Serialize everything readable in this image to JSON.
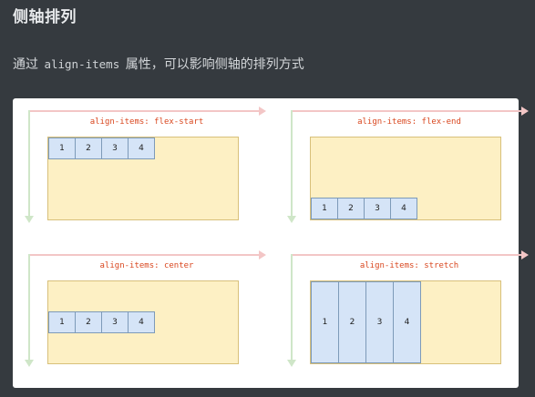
{
  "header": {
    "title": "侧轴排列",
    "desc_before": "通过",
    "desc_code": "align-items",
    "desc_after": "属性，可以影响侧轴的排列方式"
  },
  "figure": {
    "panels": [
      {
        "title": "align-items: flex-start",
        "items": [
          "1",
          "2",
          "3",
          "4"
        ]
      },
      {
        "title": "align-items: flex-end",
        "items": [
          "1",
          "2",
          "3",
          "4"
        ]
      },
      {
        "title": "align-items: center",
        "items": [
          "1",
          "2",
          "3",
          "4"
        ]
      },
      {
        "title": "align-items: stretch",
        "items": [
          "1",
          "2",
          "3",
          "4"
        ]
      }
    ]
  },
  "colors": {
    "background": "#353a3f",
    "main_axis": "#f3c6c6",
    "cross_axis": "#cfe6c8",
    "container_fill": "#fdf0c4",
    "item_fill": "#d5e4f7",
    "title_text": "#d9471f"
  },
  "icons": {
    "main_axis": "main-axis-arrow-icon",
    "cross_axis": "cross-axis-arrow-icon"
  }
}
